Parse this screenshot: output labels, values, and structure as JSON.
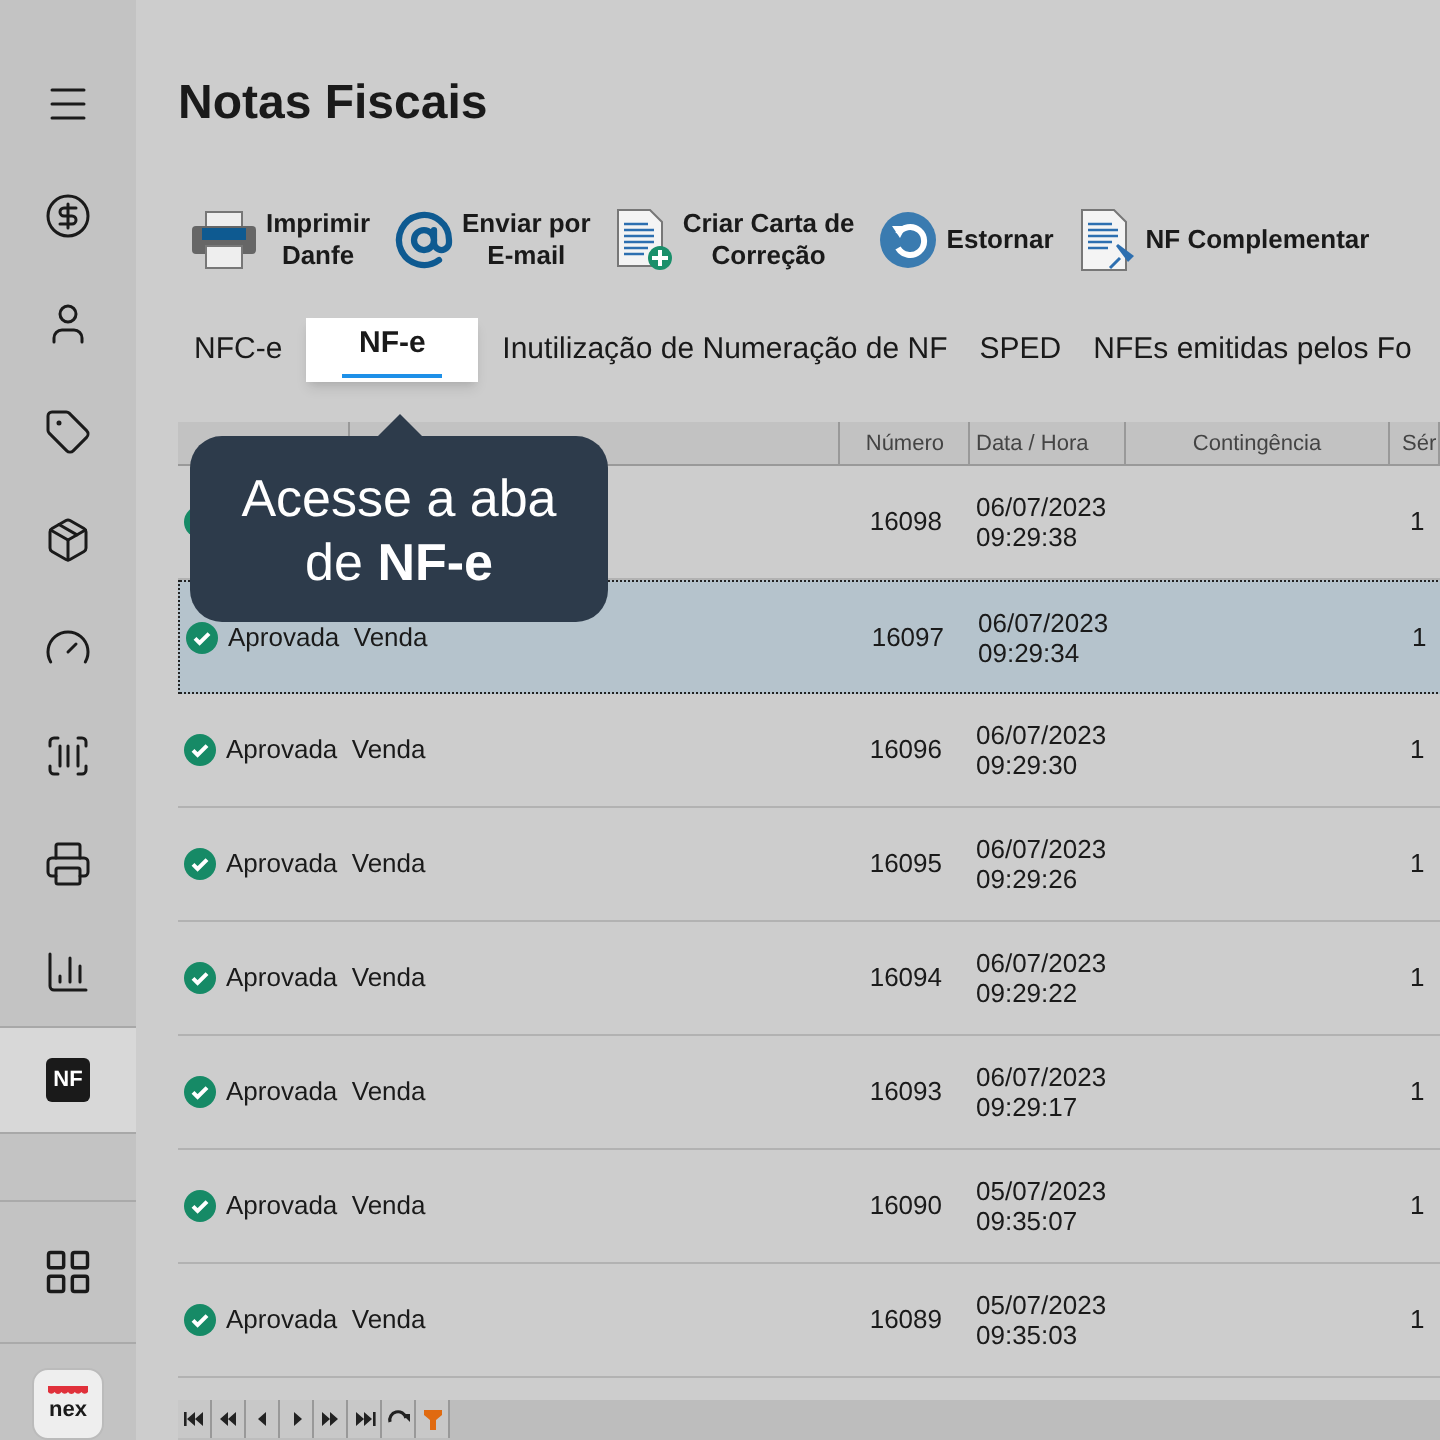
{
  "sidebar": {
    "items": [
      {
        "kind": "menu",
        "selected": false
      },
      {
        "kind": "dollar",
        "selected": false
      },
      {
        "kind": "user",
        "selected": false
      },
      {
        "kind": "tag",
        "selected": false
      },
      {
        "kind": "box",
        "selected": false
      },
      {
        "kind": "gauge",
        "selected": false
      },
      {
        "kind": "barcode",
        "selected": false
      },
      {
        "kind": "register",
        "selected": false
      },
      {
        "kind": "chart",
        "selected": false
      },
      {
        "kind": "nf",
        "label": "NF",
        "selected": true
      }
    ],
    "apps": {
      "kind": "grid"
    },
    "logo": {
      "label": "nex"
    }
  },
  "title": "Notas Fiscais",
  "toolbar": [
    {
      "kind": "printer",
      "label": "Imprimir\nDanfe"
    },
    {
      "kind": "at",
      "label": "Enviar por\nE-mail"
    },
    {
      "kind": "doc_plus",
      "label": "Criar Carta de\nCorreção"
    },
    {
      "kind": "undo",
      "label": "Estornar"
    },
    {
      "kind": "doc_pin",
      "label": "NF Complementar"
    }
  ],
  "tabs": [
    {
      "label": "NFC-e",
      "selected": false
    },
    {
      "label": "NF-e",
      "selected": true
    },
    {
      "label": "Inutilização de Numeração de NF",
      "selected": false
    },
    {
      "label": "SPED",
      "selected": false
    },
    {
      "label": "NFEs emitidas pelos Fo",
      "selected": false
    }
  ],
  "table": {
    "columns": [
      "Número",
      "Data / Hora",
      "Contingência",
      "Sér"
    ],
    "rows": [
      {
        "number": "16098",
        "date": "06/07/2023",
        "time": "09:29:38",
        "serie": "1",
        "selected": false
      },
      {
        "status": "Aprovada  Venda",
        "number": "16097",
        "date": "06/07/2023",
        "time": "09:29:34",
        "serie": "1",
        "selected": true
      },
      {
        "status": "Aprovada  Venda",
        "number": "16096",
        "date": "06/07/2023",
        "time": "09:29:30",
        "serie": "1",
        "selected": false
      },
      {
        "status": "Aprovada  Venda",
        "number": "16095",
        "date": "06/07/2023",
        "time": "09:29:26",
        "serie": "1",
        "selected": false
      },
      {
        "status": "Aprovada  Venda",
        "number": "16094",
        "date": "06/07/2023",
        "time": "09:29:22",
        "serie": "1",
        "selected": false
      },
      {
        "status": "Aprovada  Venda",
        "number": "16093",
        "date": "06/07/2023",
        "time": "09:29:17",
        "serie": "1",
        "selected": false
      },
      {
        "status": "Aprovada  Venda",
        "number": "16090",
        "date": "05/07/2023",
        "time": "09:35:07",
        "serie": "1",
        "selected": false
      },
      {
        "status": "Aprovada  Venda",
        "number": "16089",
        "date": "05/07/2023",
        "time": "09:35:03",
        "serie": "1",
        "selected": false
      }
    ]
  },
  "tooltip": {
    "text": "Acesse a aba de **NF-e**"
  }
}
